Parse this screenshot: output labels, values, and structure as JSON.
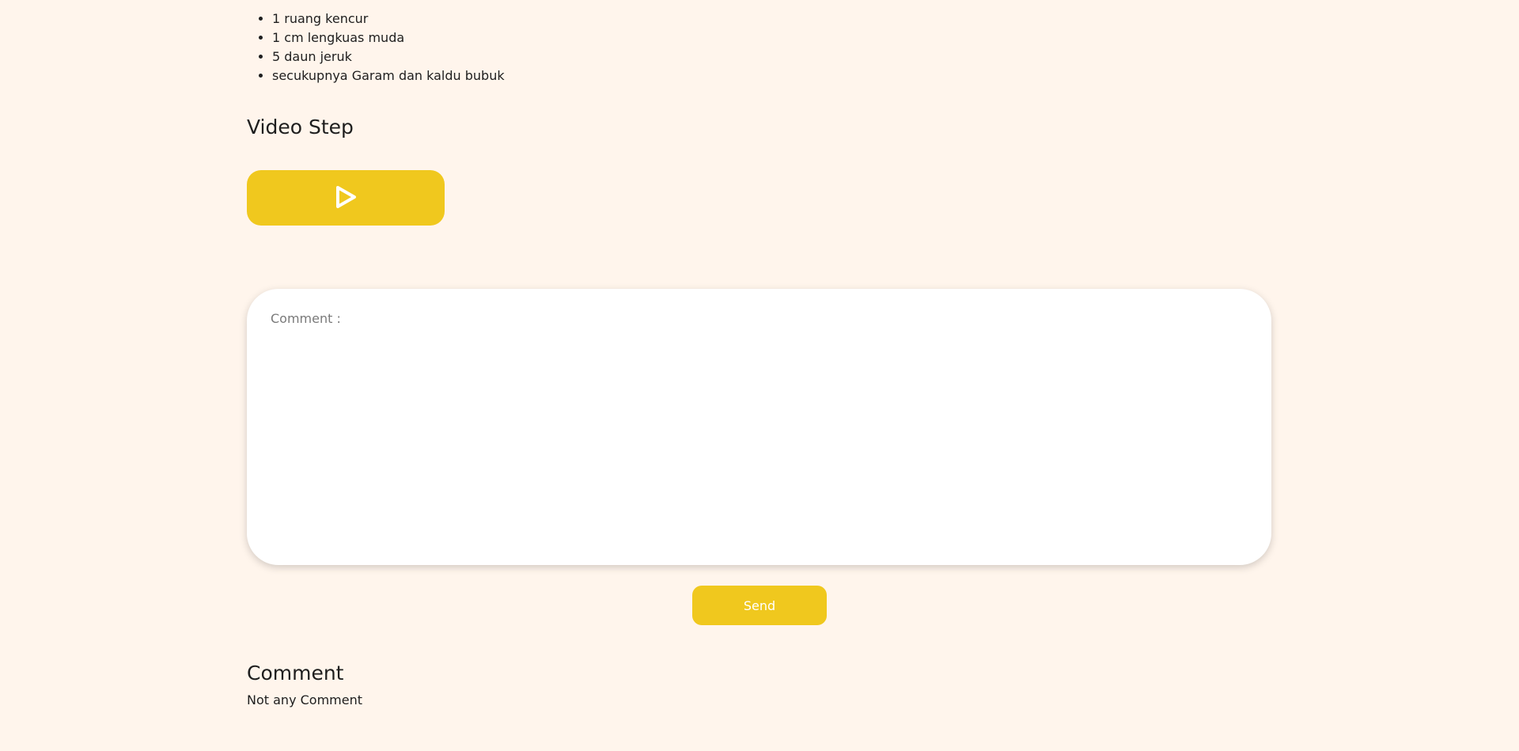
{
  "ingredients": {
    "items": [
      "1 ruang kencur",
      "1 cm lengkuas muda",
      "5 daun jeruk",
      "secukupnya Garam dan kaldu bubuk"
    ]
  },
  "video_step": {
    "title": "Video Step",
    "play_icon": "play-icon"
  },
  "comment_form": {
    "placeholder": "Comment :",
    "value": "",
    "send_label": "Send"
  },
  "comments": {
    "title": "Comment",
    "empty_text": "Not any Comment"
  },
  "colors": {
    "background": "#fff5ec",
    "accent": "#f0c81e"
  }
}
